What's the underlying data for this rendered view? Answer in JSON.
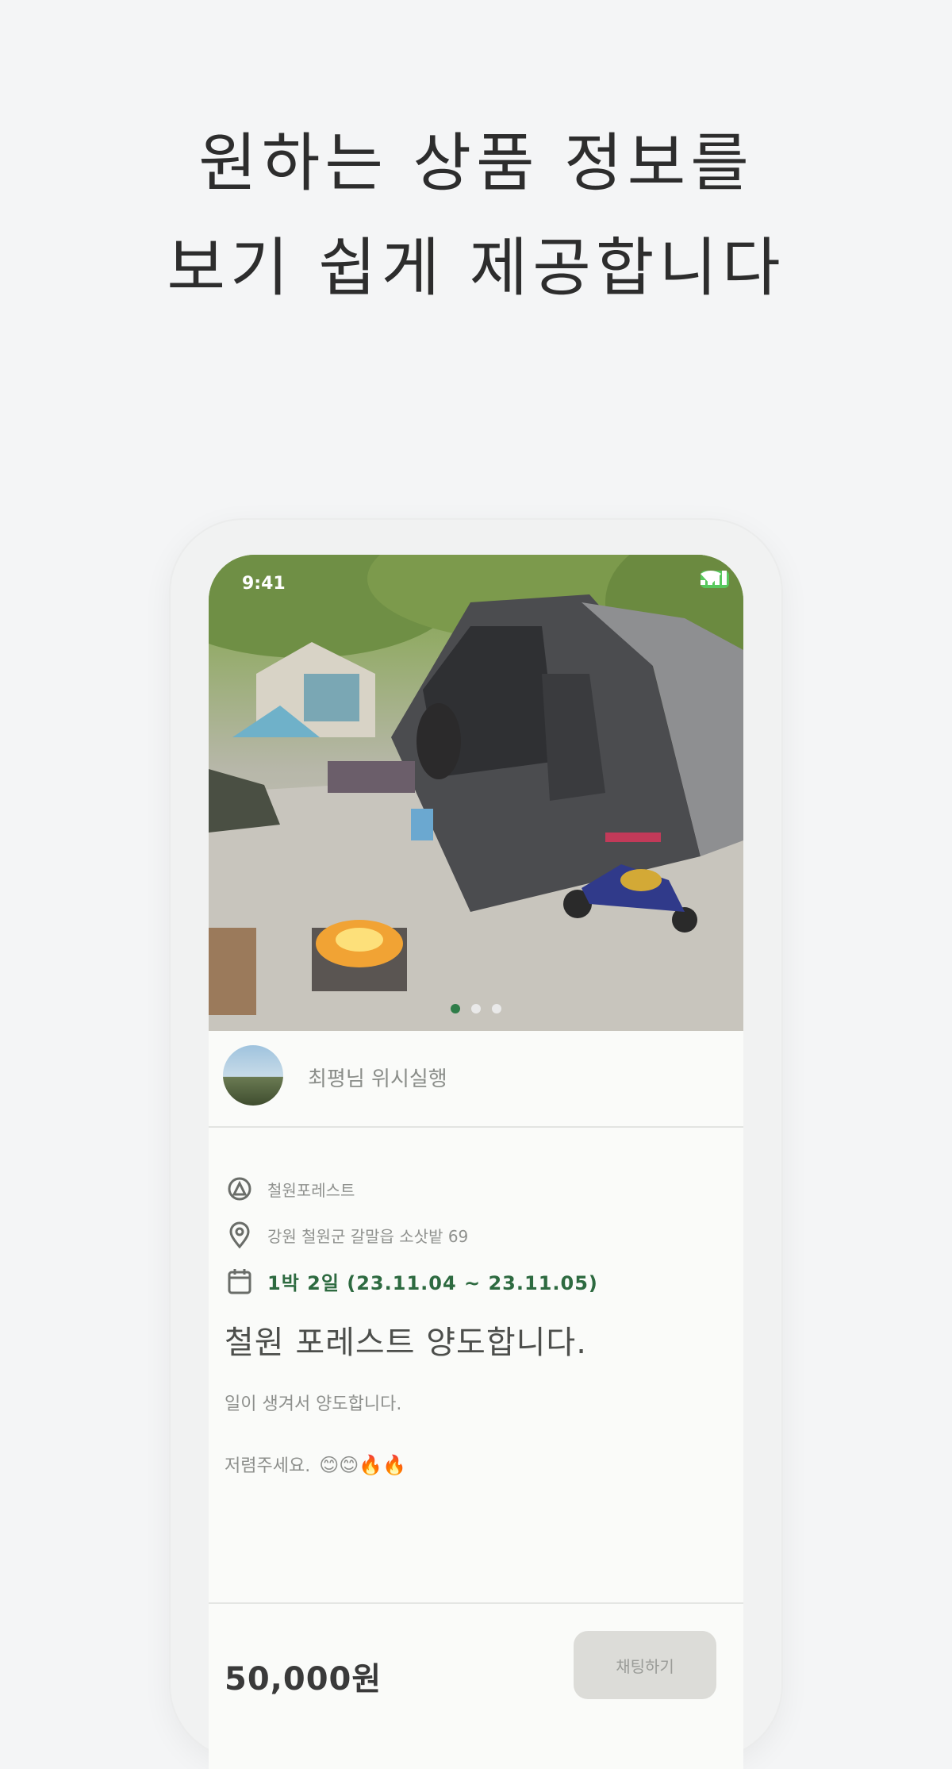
{
  "headline": {
    "line1": "원하는 상품 정보를",
    "line2": "보기 쉽게 제공합니다"
  },
  "status_bar": {
    "time": "9:41",
    "icons": [
      "signal-icon",
      "wifi-icon",
      "battery-icon"
    ],
    "battery_color": "#58c85c"
  },
  "carousel": {
    "image": "campsite photo with tent, tricycle and campfire",
    "slide_count": 3,
    "active_index": 0,
    "active_dot_color": "#2f7d49"
  },
  "seller": {
    "name": "최평님 위시실행"
  },
  "listing": {
    "site_name": "철원포레스트",
    "address": "강원 철원군 갈말읍 소삿밭 69",
    "period": "1박 2일  (23.11.04 ~ 23.11.05)",
    "title": "철원 포레스트 양도합니다.",
    "description": "일이 생겨서 양도합니다.",
    "note": "저렴주세요."
  },
  "footer": {
    "price": "50,000원",
    "chat_button": "채팅하기"
  },
  "icons": {
    "site": "campsite-icon",
    "location": "location-pin-icon",
    "calendar": "calendar-icon"
  },
  "colors": {
    "accent_green": "#2d6a40",
    "background": "#f4f5f6"
  }
}
